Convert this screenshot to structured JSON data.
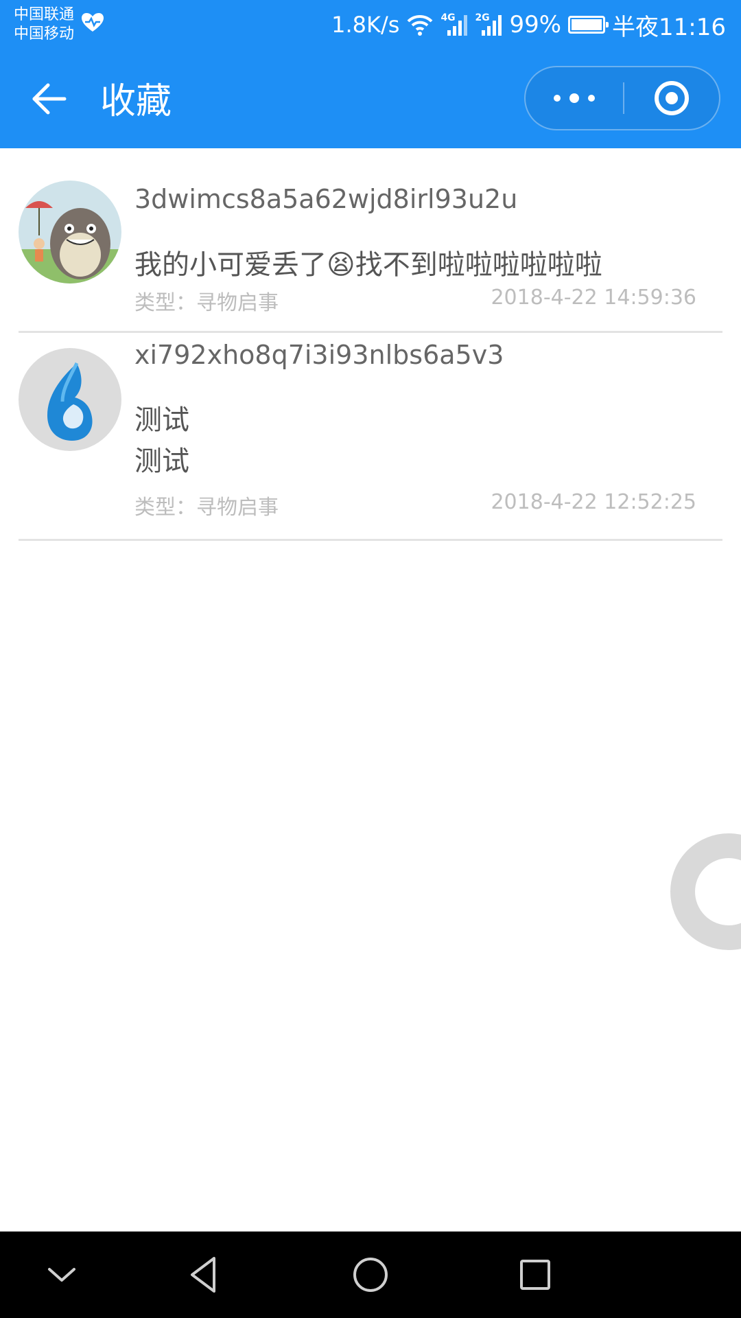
{
  "status_bar": {
    "carrier1": "中国联通",
    "carrier2": "中国移动",
    "net_speed": "1.8K/s",
    "net1": "4G",
    "net2": "2G",
    "battery_percent": "99%",
    "battery_level": 0.99,
    "time": "半夜11:16",
    "icons": [
      "heart-health-icon",
      "wifi-icon",
      "signal-icon",
      "battery-icon"
    ]
  },
  "nav": {
    "title": "收藏",
    "icons": [
      "back-arrow-icon",
      "more-dots-icon",
      "target-icon"
    ]
  },
  "items": [
    {
      "username": "3dwimcs8a5a62wjd8irl93u2u",
      "content_lines": [
        "我的小可爱丢了😫找不到啦啦啦啦啦啦"
      ],
      "type_label": "类型：",
      "type_value": "寻物启事",
      "time": "2018-4-22 14:59:36",
      "avatar": "totoro-avatar"
    },
    {
      "username": "xi792xho8q7i3i93nlbs6a5v3",
      "content_lines": [
        "测试",
        "测试"
      ],
      "type_label": "类型：",
      "type_value": "寻物启事",
      "time": "2018-4-22 12:52:25",
      "avatar": "blue-drop-avatar"
    }
  ],
  "colors": {
    "accent": "#1e8ff5",
    "text_primary": "#555555",
    "text_muted": "#bdbdbd",
    "separator": "#e3e3e3"
  },
  "android_nav": {
    "icons": [
      "collapse-icon",
      "back-triangle-icon",
      "home-circle-icon",
      "recents-square-icon"
    ]
  }
}
